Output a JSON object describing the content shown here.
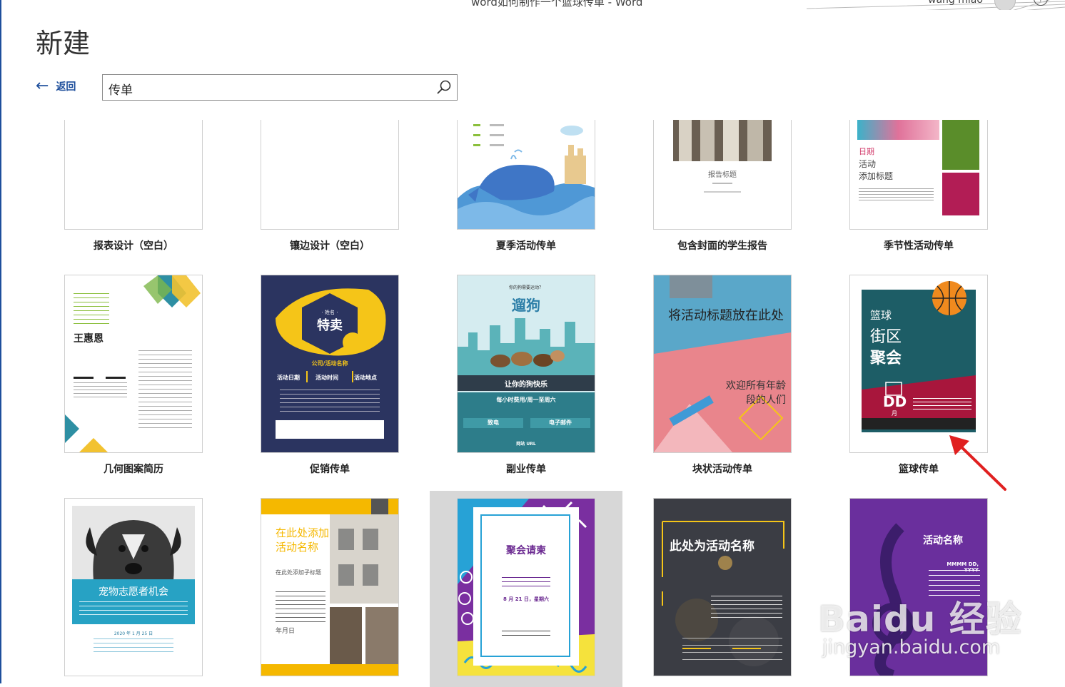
{
  "window": {
    "title": "word如何制作一个篮球传单 - Word",
    "user_name": "wang miao"
  },
  "page": {
    "title": "新建",
    "back_label": "返回",
    "back_arrow": "←"
  },
  "search": {
    "value": "传单"
  },
  "templates": [
    {
      "label": "报表设计（空白）"
    },
    {
      "label": "镶边设计（空白）"
    },
    {
      "label": "夏季活动传单"
    },
    {
      "label": "包含封面的学生报告"
    },
    {
      "label": "季节性活动传单"
    },
    {
      "label": "几何图案简历"
    },
    {
      "label": "促销传单"
    },
    {
      "label": "副业传单"
    },
    {
      "label": "块状活动传单"
    },
    {
      "label": "篮球传单"
    }
  ],
  "thumbnails": {
    "student_report": {
      "title": "报告标题"
    },
    "seasonal": {
      "line1": "日期",
      "line2": "活动",
      "line3": "添加标题"
    },
    "resume": {
      "name": "王惠恩"
    },
    "promo": {
      "badge_small": "· 姓名 ·",
      "badge_main": "特卖",
      "subtitle": "公司/活动名称",
      "c1": "活动日期",
      "c2": "活动时间",
      "c3": "活动地点"
    },
    "side_biz": {
      "question": "你的狗需要运动？",
      "title": "遛狗",
      "slogan": "让你的狗快乐",
      "price": "每小时费用/周一至周六",
      "call": "致电",
      "email": "电子邮件",
      "site": "网站 URL"
    },
    "block_event": {
      "title": "将活动标题放在此处",
      "welcome": "欢迎所有年龄段的人们"
    },
    "basketball": {
      "l1": "篮球",
      "l2": "街区",
      "l3": "聚会",
      "dd": "DD",
      "month": "月"
    },
    "pet": {
      "title": "宠物志愿者机会",
      "date": "2020 年 1 月 25 日"
    },
    "house": {
      "title": "在此处添加活动名称",
      "sub": "在此处添加子标题",
      "date": "年月日"
    },
    "party": {
      "title": "聚会请柬",
      "date": "8 月 21 日，星期六"
    },
    "night_event": {
      "title": "此处为活动名称"
    },
    "music": {
      "title": "活动名称",
      "date": "MMMM DD, YYYY"
    }
  },
  "watermark": {
    "main": "Baidu 经验",
    "sub": "jingyan.baidu.com"
  },
  "colors": {
    "accent": "#1e4f9c",
    "arrow": "#e02020"
  }
}
